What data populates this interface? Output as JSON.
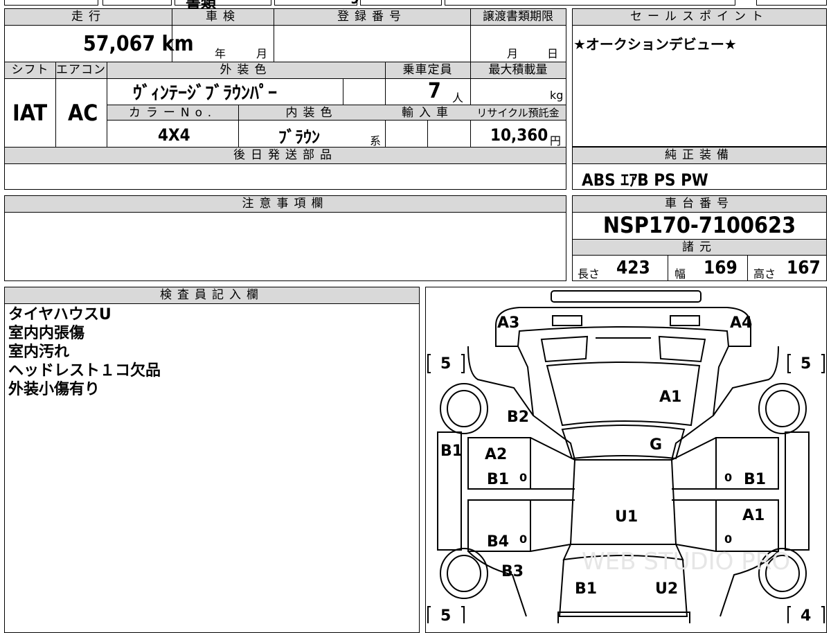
{
  "top_strip": {
    "partial": "書類",
    "partial2": "9"
  },
  "mileage": {
    "label": "走行",
    "value": "57,067 km"
  },
  "shaken": {
    "label": "車検",
    "year_unit": "年",
    "month_unit": "月"
  },
  "registration": {
    "label": "登録番号",
    "value": ""
  },
  "transfer_deadline": {
    "label": "譲渡書類期限",
    "month_unit": "月",
    "day_unit": "日"
  },
  "sales_point": {
    "label": "セールスポイント",
    "text": "★オークションデビュー★"
  },
  "shift": {
    "label": "シフト",
    "value": "IAT"
  },
  "aircon": {
    "label": "エアコン",
    "value": "AC"
  },
  "exterior_color": {
    "label": "外装色",
    "value": "ｳﾞｨﾝﾃｰｼﾞﾌﾞﾗｳﾝﾊﾟｰ"
  },
  "capacity": {
    "label": "乗車定員",
    "value": "7",
    "unit": "人"
  },
  "max_load": {
    "label": "最大積載量",
    "unit": "kg"
  },
  "color_no": {
    "label": "カラーNo.",
    "value": "4X4"
  },
  "interior_color": {
    "label": "内装色",
    "value": "ﾌﾞﾗｳﾝ",
    "suffix": "系"
  },
  "import_car": {
    "label": "輸入車"
  },
  "recycle": {
    "label": "リサイクル預託金",
    "value": "10,360",
    "unit": "円"
  },
  "later_parts": {
    "label": "後日発送部品"
  },
  "equipment": {
    "label": "純正装備",
    "value": "ABS ｴｱB PS PW"
  },
  "notes": {
    "label": "注意事項欄"
  },
  "chassis": {
    "label": "車台番号",
    "value": "NSP170-7100623"
  },
  "specs": {
    "label": "諸元",
    "length_label": "長さ",
    "length": "423",
    "width_label": "幅",
    "width": "169",
    "height_label": "高さ",
    "height": "167"
  },
  "inspector": {
    "label": "検査員記入欄",
    "lines": [
      "タイヤハウスU",
      "室内内張傷",
      "室内汚れ",
      "ヘッドレスト１コ欠品",
      "外装小傷有り"
    ]
  },
  "diagram": {
    "codes": {
      "front_left": "A3",
      "front_right": "A4",
      "hood": "A1",
      "left_fender": "B2",
      "windshield": "G",
      "left_pillar": "B1",
      "left_front_door_1": "A2",
      "left_front_door_2": "B1",
      "right_front_door": "B1",
      "roof": "U1",
      "right_rear_door": "A1",
      "left_rear_door": "B4",
      "left_rear_quarter": "B3",
      "rear_left": "B1",
      "rear_right": "U2"
    },
    "tire_marks": {
      "front_left": "5",
      "front_right": "5",
      "rear_left": "5",
      "rear_right": "4"
    },
    "seat_marks": [
      "0",
      "0",
      "0",
      "0"
    ],
    "watermark": "WEB STUDIO PRO"
  }
}
